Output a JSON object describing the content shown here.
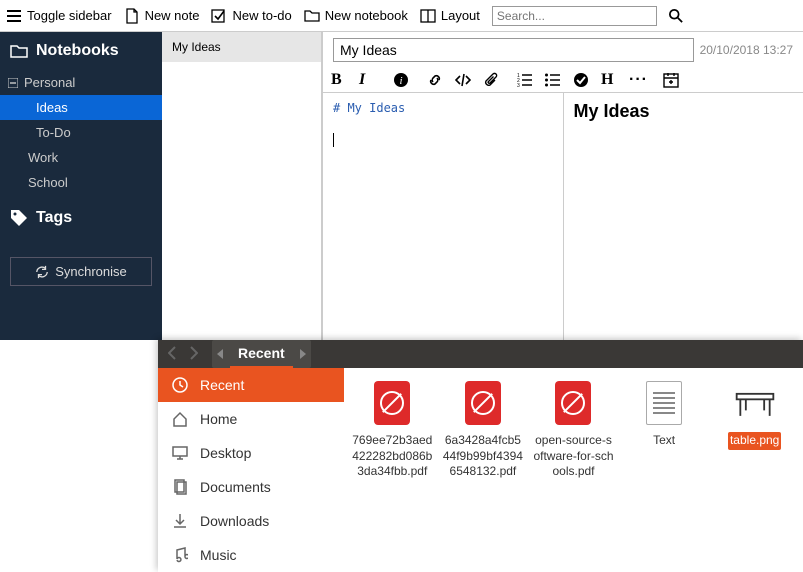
{
  "toolbar": {
    "toggle_sidebar": "Toggle sidebar",
    "new_note": "New note",
    "new_todo": "New to-do",
    "new_notebook": "New notebook",
    "layout": "Layout",
    "search_placeholder": "Search..."
  },
  "sidebar": {
    "notebooks_header": "Notebooks",
    "tags_header": "Tags",
    "sync_label": "Synchronise",
    "notebooks": [
      {
        "label": "Personal",
        "children": [
          {
            "label": "Ideas",
            "active": true
          },
          {
            "label": "To-Do",
            "active": false
          }
        ]
      },
      {
        "label": "Work",
        "children": []
      },
      {
        "label": "School",
        "children": []
      }
    ]
  },
  "notelist": {
    "items": [
      "My Ideas"
    ]
  },
  "editor": {
    "title": "My Ideas",
    "date": "20/10/2018 13:27",
    "markdown": "# My Ideas",
    "preview_heading": "My Ideas"
  },
  "picker": {
    "breadcrumb": "Recent",
    "sidebar": [
      {
        "label": "Recent",
        "icon": "clock",
        "active": true
      },
      {
        "label": "Home",
        "icon": "home",
        "active": false
      },
      {
        "label": "Desktop",
        "icon": "desktop",
        "active": false
      },
      {
        "label": "Documents",
        "icon": "documents",
        "active": false
      },
      {
        "label": "Downloads",
        "icon": "downloads",
        "active": false
      },
      {
        "label": "Music",
        "icon": "music",
        "active": false
      }
    ],
    "files": [
      {
        "label": "769ee72b3aed422282bd086b3da34fbb.pdf",
        "type": "pdf",
        "selected": false
      },
      {
        "label": "6a3428a4fcb544f9b99bf43946548132.pdf",
        "type": "pdf",
        "selected": false
      },
      {
        "label": "open-source-software-for-schools.pdf",
        "type": "pdf",
        "selected": false
      },
      {
        "label": "Text",
        "type": "txt",
        "selected": false
      },
      {
        "label": "table.png",
        "type": "table",
        "selected": true
      }
    ]
  }
}
